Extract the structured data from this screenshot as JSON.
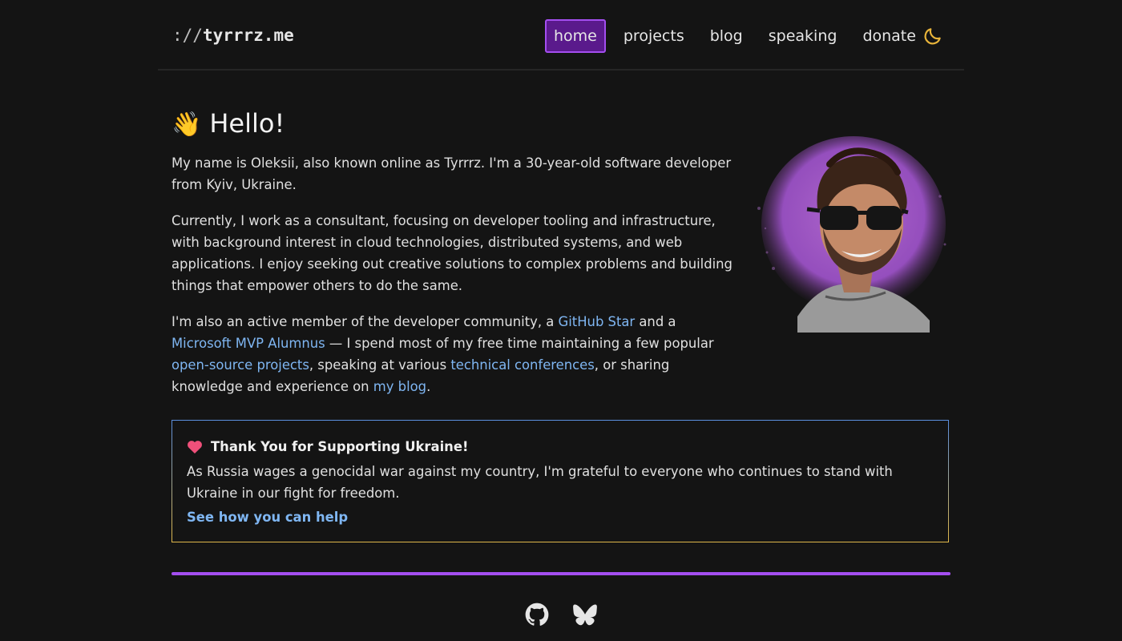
{
  "header": {
    "logo_proto": "://",
    "logo_host": "tyrrrz.me",
    "nav": [
      {
        "label": "home",
        "active": true
      },
      {
        "label": "projects"
      },
      {
        "label": "blog"
      },
      {
        "label": "speaking"
      },
      {
        "label": "donate"
      }
    ],
    "theme_icon": "moon-icon"
  },
  "main": {
    "title": "Hello!",
    "title_icon": "waving-hand-icon",
    "p1": "My name is Oleksii, also known online as Tyrrrz. I'm a 30-year-old software developer from Kyiv, Ukraine.",
    "p2": "Currently, I work as a consultant, focusing on developer tooling and infrastructure, with background interest in cloud technologies, distributed systems, and web applications. I enjoy seeking out creative solutions to complex problems and building things that empower others to do the same.",
    "p3": {
      "t1": "I'm also an active member of the developer community, a ",
      "link1": "GitHub Star",
      "t2": " and a ",
      "link2": "Microsoft MVP Alumnus",
      "t3": " — I spend most of my free time maintaining a few popular ",
      "link3": "open-source projects",
      "t4": ", speaking at various ",
      "link4": "technical conferences",
      "t5": ", or sharing knowledge and experience on ",
      "link5": "my blog",
      "t6": "."
    }
  },
  "support": {
    "title": "Thank You for Supporting Ukraine!",
    "text": "As Russia wages a genocidal war against my country, I'm grateful to everyone who continues to stand with Ukraine in our fight for freedom.",
    "link": "See how you can help",
    "icon": "heart-icon"
  },
  "footer": {
    "icons": [
      "github-icon",
      "bluesky-icon"
    ]
  },
  "colors": {
    "accent": "#a44ef0",
    "link": "#7fb6f2",
    "background": "#141414"
  }
}
